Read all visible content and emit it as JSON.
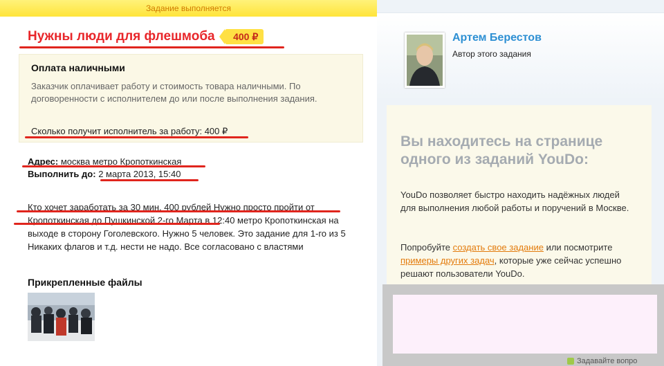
{
  "status_banner": "Задание выполняется",
  "task": {
    "title": "Нужны люди для флешмоба",
    "price": "400 ₽",
    "payment": {
      "title": "Оплата наличными",
      "description": "Заказчик оплачивает работу и стоимость товара наличными. По договоренности с исполнителем до или после выполнения задания.",
      "earnings": "Сколько получит исполнитель за работу: 400 ₽"
    },
    "address_label": "Адрес:",
    "address_value": "москва метро Кропоткинская",
    "deadline_label": "Выполнить до:",
    "deadline_value": "2 марта 2013, 15:40",
    "description_part1": "Кто хочет заработать за 30 мин. 400 рублей Нужно просто пройти от ",
    "description_part2": "Кропоткинская до Пушкинской  2-го Марта",
    "description_part3": " в 12:40 метро Кропоткинская на выходе в сторону Гоголевского.  Нужно 5 человек. Это задание для 1-го из 5 Никаких флагов и т.д. нести не надо. Все согласовано с властями",
    "files_title": "Прикрепленные файлы"
  },
  "author": {
    "name": "Артем Берестов",
    "role": "Автор этого задания"
  },
  "info_panel": {
    "title": "Вы находитесь на странице одного из заданий YouDo:",
    "text1": "YouDo позволяет быстро находить надёжных людей для выполнения любой работы и поручений в Москве.",
    "text2_prefix": "Попробуйте ",
    "link_create": "создать свое задание",
    "text2_mid": " или посмотрите ",
    "link_examples": "примеры других задач",
    "text2_suffix": ", которые уже сейчас успешно решают пользователи YouDo."
  },
  "bottom_peek_text": "Задавайте вопро",
  "colors": {
    "title_red": "#e8262a",
    "price_bg": "#ffe044",
    "author_blue": "#2d8fd3",
    "link_orange": "#e37b0c",
    "annotation_red": "#e0251d"
  },
  "icons": [
    "avatar-photo",
    "attachment-photo"
  ]
}
